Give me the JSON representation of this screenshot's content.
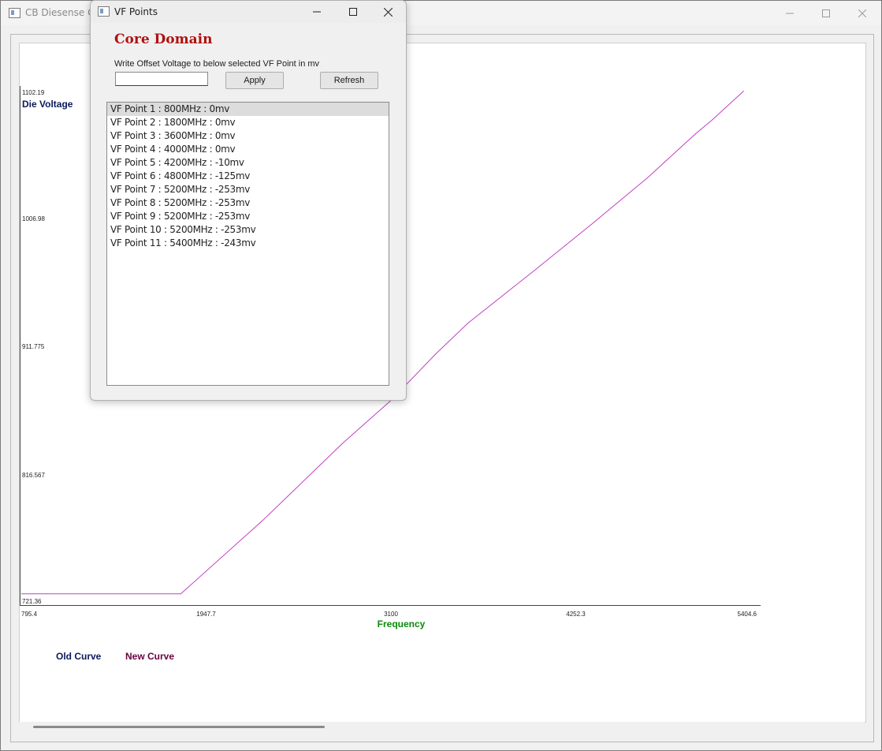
{
  "main_window": {
    "title": "CB Diesense Cu"
  },
  "chart_data": {
    "type": "line",
    "ylabel": "Die Voltage",
    "xlabel": "Frequency",
    "y_ticks": [
      "1102.19",
      "1006.98",
      "911.775",
      "816.567",
      "721.36"
    ],
    "x_ticks": [
      "795.4",
      "1947.7",
      "3100",
      "4252.3",
      "5404.6"
    ],
    "xlim": [
      795.4,
      5404.6
    ],
    "ylim": [
      721.36,
      1102.19
    ],
    "series": [
      {
        "name": "New Curve",
        "color": "#c040c0",
        "x": [
          795.4,
          1790,
          2300,
          2800,
          3100,
          3380,
          3580,
          4000,
          4350,
          4700,
          5000,
          5100,
          5300
        ],
        "y": [
          725,
          725,
          780,
          838,
          870,
          905,
          928,
          968,
          1002,
          1037,
          1070,
          1080,
          1102
        ]
      }
    ],
    "legend": [
      {
        "label": "Old Curve",
        "color": "#0a1a5a"
      },
      {
        "label": "New Curve",
        "color": "#6a0040"
      }
    ]
  },
  "dialog": {
    "title": "VF Points",
    "heading": "Core Domain",
    "instruction": "Write Offset Voltage to below selected VF Point in mv",
    "offset_value": "",
    "apply_label": "Apply",
    "refresh_label": "Refresh",
    "vf_points": [
      "VF Point 1 : 800MHz : 0mv",
      "VF Point 2 : 1800MHz : 0mv",
      "VF Point 3 : 3600MHz : 0mv",
      "VF Point 4 : 4000MHz : 0mv",
      "VF Point 5 : 4200MHz : -10mv",
      "VF Point 6 : 4800MHz : -125mv",
      "VF Point 7 : 5200MHz : -253mv",
      "VF Point 8 : 5200MHz : -253mv",
      "VF Point 9 : 5200MHz : -253mv",
      "VF Point 10 : 5200MHz : -253mv",
      "VF Point 11 : 5400MHz : -243mv"
    ],
    "selected_index": 0
  }
}
